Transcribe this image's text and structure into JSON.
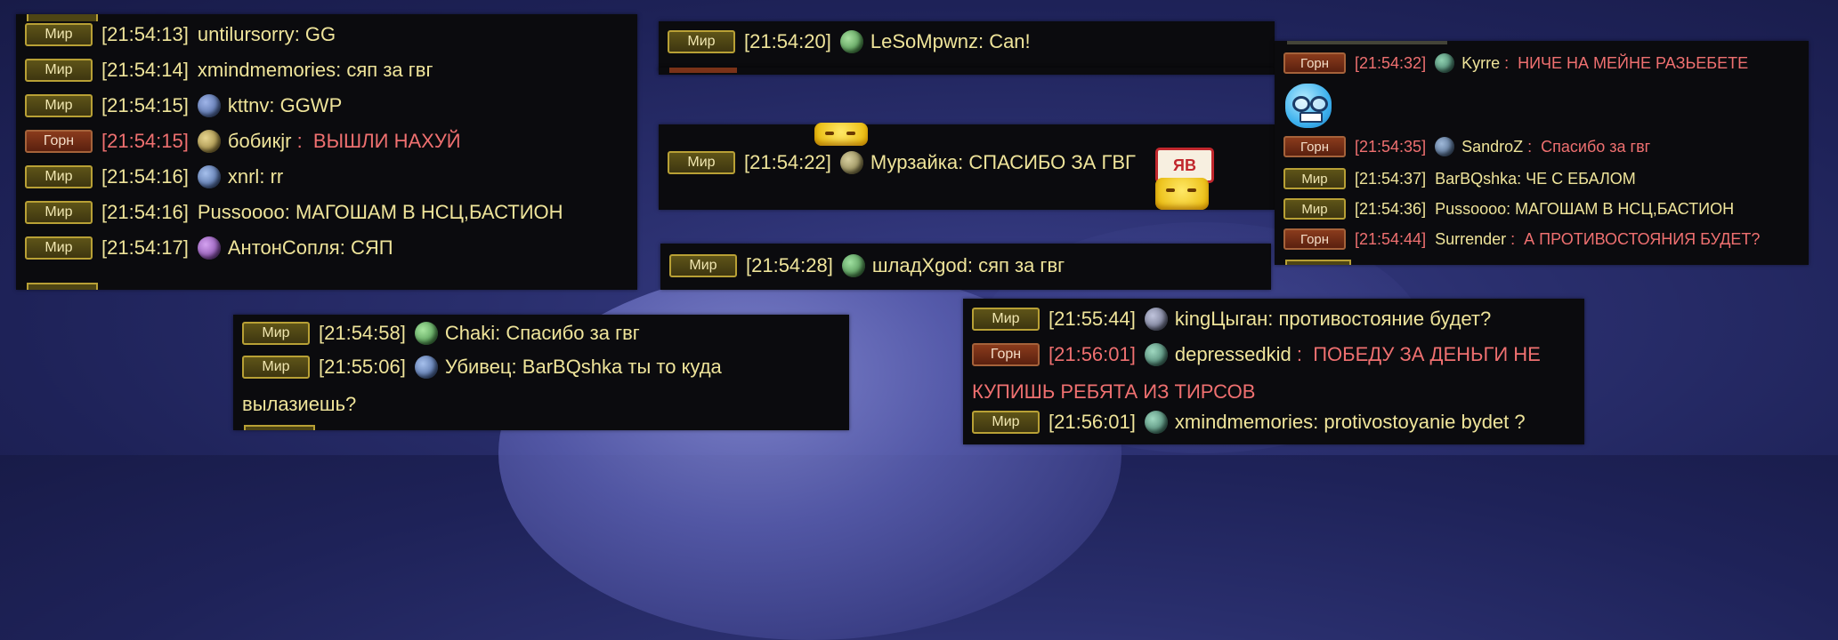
{
  "tags": {
    "world": "Мир",
    "horde": "Горн"
  },
  "colors": {
    "world_text": "#efe49a",
    "horde_text": "#ef7070",
    "panel_bg": "#0b0b0e"
  },
  "panel1": {
    "rows": [
      {
        "tag": "Мир",
        "time": "[21:54:13]",
        "name": "untilursorry",
        "message": "GG",
        "channel": "world"
      },
      {
        "tag": "Мир",
        "time": "[21:54:14]",
        "name": "xmindmemories",
        "message": "сяп за гвг",
        "channel": "world"
      },
      {
        "tag": "Мир",
        "time": "[21:54:15]",
        "name": "kttnv",
        "message": "GGWP",
        "channel": "world",
        "icon": "class-emblem-icon"
      },
      {
        "tag": "Горн",
        "time": "[21:54:15]",
        "name": "бобикjr",
        "message": "ВЫШЛИ НАХУЙ",
        "channel": "horde",
        "icon": "class-emblem-icon"
      },
      {
        "tag": "Мир",
        "time": "[21:54:16]",
        "name": "xnrl",
        "message": "rr",
        "channel": "world",
        "icon": "class-emblem-icon"
      },
      {
        "tag": "Мир",
        "time": "[21:54:16]",
        "name": "Pussoooo",
        "message": "МАГОШАМ В НСЦ,БАСТИОН",
        "channel": "world"
      },
      {
        "tag": "Мир",
        "time": "[21:54:17]",
        "name": "АнтонСопля",
        "message": "СЯП",
        "channel": "world",
        "icon": "class-emblem-icon"
      }
    ]
  },
  "panel2": {
    "rows": [
      {
        "tag": "Мир",
        "time": "[21:54:20]",
        "name": "LeSoMpwnz",
        "message": "Can!",
        "channel": "world",
        "icon": "class-emblem-icon"
      }
    ]
  },
  "panel3": {
    "rows": [
      {
        "tag": "Мир",
        "time": "[21:54:22]",
        "name": "Мурзайка",
        "message": "СПАСИБО ЗА ГВГ",
        "channel": "world",
        "icon": "class-emblem-icon"
      }
    ],
    "stamp_text": "ЯВ"
  },
  "panel4": {
    "rows": [
      {
        "tag": "Мир",
        "time": "[21:54:28]",
        "name": "шладXgod",
        "message": "сяп за гвг",
        "channel": "world",
        "icon": "class-emblem-icon"
      }
    ]
  },
  "panel5": {
    "rows": [
      {
        "tag": "Горн",
        "time": "[21:54:32]",
        "name": "Kyrre",
        "message": "НИЧЕ НА МЕЙНЕ РАЗЬЕБЕТЕ",
        "channel": "horde",
        "icon": "class-emblem-icon"
      },
      {
        "tag": "Горн",
        "time": "[21:54:35]",
        "name": "SandroZ",
        "message": "Спасибо за гвг",
        "channel": "horde",
        "icon": "class-emblem-icon"
      },
      {
        "tag": "Мир",
        "time": "[21:54:37]",
        "name": "BarBQshka",
        "message": "ЧЕ С ЕБАЛОМ",
        "channel": "world"
      },
      {
        "tag": "Мир",
        "time": "[21:54:36]",
        "name": "Pussoooo",
        "message": "МАГОШАМ В НСЦ,БАСТИОН",
        "channel": "world"
      },
      {
        "tag": "Горн",
        "time": "[21:54:44]",
        "name": "Surrender",
        "message": "А ПРОТИВОСТОЯНИЯ БУДЕТ?",
        "channel": "horde"
      }
    ]
  },
  "panel6": {
    "rows": [
      {
        "tag": "Мир",
        "time": "[21:54:58]",
        "name": "Chaki",
        "message": "Спасибо за гвг",
        "channel": "world",
        "icon": "class-emblem-icon"
      },
      {
        "tag": "Мир",
        "time": "[21:55:06]",
        "name": "Убивец",
        "message": "BarBQshka ты то куда",
        "channel": "world",
        "icon": "class-emblem-icon"
      }
    ],
    "continuation": "вылазиешь?"
  },
  "panel7": {
    "rows": [
      {
        "tag": "Мир",
        "time": "[21:55:44]",
        "name": "kingЦыган",
        "message": "противостояние будет?",
        "channel": "world",
        "icon": "class-emblem-icon"
      },
      {
        "tag": "Горн",
        "time": "[21:56:01]",
        "name": "depressedkid",
        "message": "ПОБЕДУ ЗА ДЕНЬГИ НЕ",
        "channel": "horde",
        "icon": "class-emblem-icon"
      },
      {
        "tag": "Мир",
        "time": "[21:56:01]",
        "name": "xmindmemories",
        "message": "protivostoyanie bydet ?",
        "channel": "world",
        "icon": "class-emblem-icon"
      }
    ],
    "continuation": "КУПИШЬ РЕБЯТА ИЗ  ТИРСОВ"
  }
}
